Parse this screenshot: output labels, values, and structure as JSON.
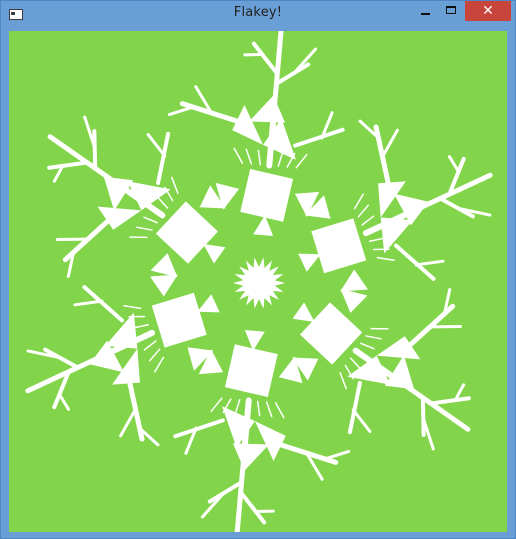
{
  "window": {
    "title": "Flakey!",
    "close_glyph": "✕"
  },
  "canvas": {
    "background": "#82d54a",
    "flake_color": "#ffffff"
  }
}
